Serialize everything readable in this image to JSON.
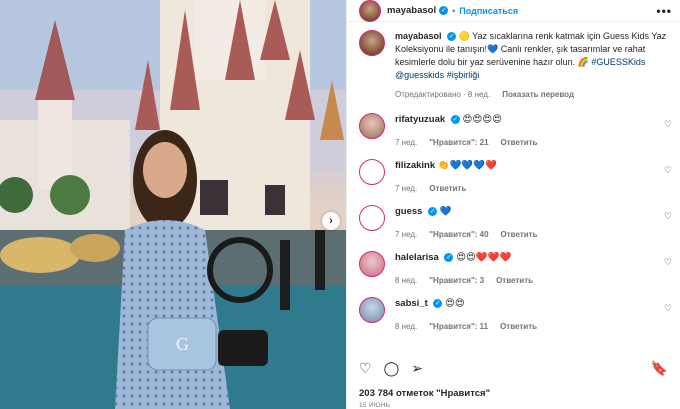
{
  "post": {
    "username": "mayabasol",
    "follow_label": "Подписаться",
    "more_label": "•••",
    "next_label": "›"
  },
  "caption": {
    "username": "mayabasol",
    "text": "🟡 Yaz sıcaklarına renk katmak için Guess Kids Yaz Koleksiyonu ile tanışın!💙 Canlı renkler, şık tasarımlar ve rahat kesimlerle dolu bir yaz serüvenine hazır olun. 🌈",
    "hashtags": "#GUESSKids",
    "mentions": "@guesskids",
    "extra_tag": "#işbirliği",
    "meta_edited": "Отредактировано · 8 нед.",
    "translate_label": "Показать перевод"
  },
  "comments": [
    {
      "username": "rifatyuzuak",
      "verified": true,
      "text": "😍😍😍😍",
      "age": "7 нед.",
      "likes": "\"Нравится\": 21",
      "reply": "Ответить"
    },
    {
      "username": "filizakink",
      "verified": false,
      "text": "👏💙💙💙❤️",
      "age": "7 нед.",
      "likes": "",
      "reply": "Ответить"
    },
    {
      "username": "guess",
      "verified": true,
      "text": "💙",
      "age": "7 нед.",
      "likes": "\"Нравится\": 40",
      "reply": "Ответить"
    },
    {
      "username": "halelarisa",
      "verified": true,
      "text": "😍😍❤️❤️❤️",
      "age": "8 нед.",
      "likes": "\"Нравится\": 3",
      "reply": "Ответить"
    },
    {
      "username": "sabsi_t",
      "verified": true,
      "text": "😍😍",
      "age": "8 нед.",
      "likes": "\"Нравится\": 11",
      "reply": "Ответить"
    }
  ],
  "footer": {
    "likes": "203 784 отметок \"Нравится\"",
    "date": "15 ИЮНЬ"
  },
  "icons": {
    "heart": "♡",
    "comment": "◯",
    "share": "➢",
    "bookmark": "🔖",
    "verified": "✓"
  },
  "colors": {
    "accent": "#0095f6",
    "ring": "#d62976"
  }
}
